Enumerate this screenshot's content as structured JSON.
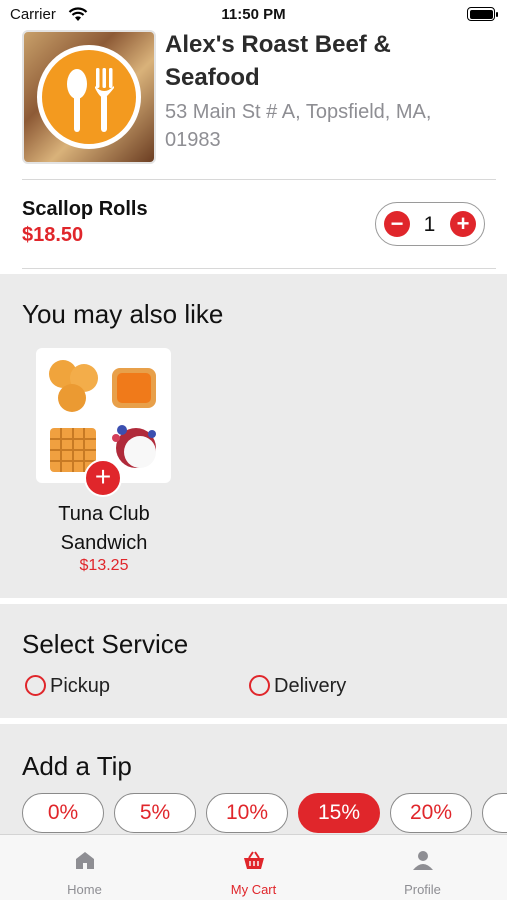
{
  "status_bar": {
    "carrier": "Carrier",
    "time": "11:50 PM"
  },
  "restaurant": {
    "name": "Alex's Roast Beef & Seafood",
    "address": "53 Main St # A, Topsfield, MA, 01983",
    "logo_icon": "fork-spoon-icon"
  },
  "cart_item": {
    "name": "Scallop Rolls",
    "price": "$18.50",
    "quantity": "1",
    "minus_label": "−",
    "plus_label": "+"
  },
  "suggestions": {
    "title": "You may also like",
    "items": [
      {
        "name": "Tuna Club Sandwich",
        "price": "$13.25",
        "add_label": "+"
      }
    ]
  },
  "service": {
    "title": "Select Service",
    "options": [
      {
        "label": "Pickup",
        "selected": false
      },
      {
        "label": "Delivery",
        "selected": false
      }
    ]
  },
  "tip": {
    "title": "Add a Tip",
    "options": [
      "0%",
      "5%",
      "10%",
      "15%",
      "20%"
    ],
    "selected": "15%"
  },
  "tabbar": {
    "tabs": [
      {
        "label": "Home",
        "icon": "home-icon",
        "active": false
      },
      {
        "label": "My Cart",
        "icon": "basket-icon",
        "active": true
      },
      {
        "label": "Profile",
        "icon": "person-icon",
        "active": false
      }
    ]
  },
  "colors": {
    "accent": "#e0262b",
    "section_bg": "#ebebeb",
    "muted": "#8e8e93",
    "logo_orange": "#f39a1f"
  }
}
